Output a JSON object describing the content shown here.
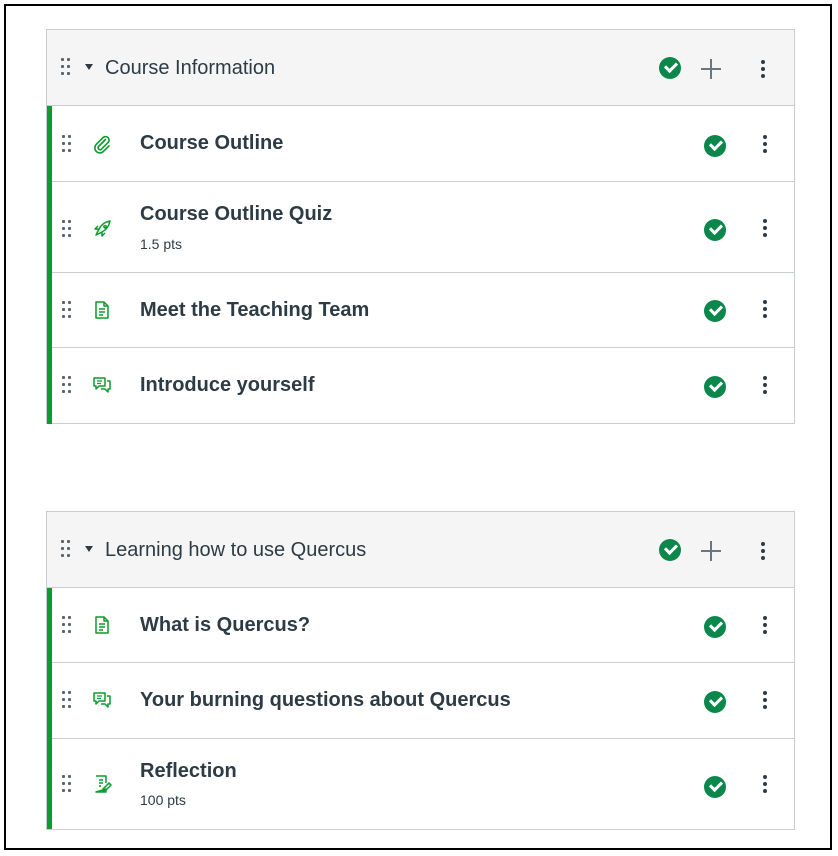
{
  "modules": [
    {
      "title": "Course Information",
      "items": [
        {
          "title": "Course Outline",
          "points": "",
          "icon": "attachment-icon"
        },
        {
          "title": "Course Outline Quiz",
          "points": "1.5 pts",
          "icon": "quiz-rocket-icon"
        },
        {
          "title": "Meet the Teaching Team",
          "points": "",
          "icon": "page-document-icon"
        },
        {
          "title": "Introduce yourself",
          "points": "",
          "icon": "discussion-icon"
        }
      ]
    },
    {
      "title": "Learning how to use Quercus",
      "items": [
        {
          "title": "What is Quercus?",
          "points": "",
          "icon": "page-document-icon"
        },
        {
          "title": "Your burning questions about Quercus",
          "points": "",
          "icon": "discussion-icon"
        },
        {
          "title": "Reflection",
          "points": "100 pts",
          "icon": "assignment-icon"
        }
      ]
    }
  ],
  "colors": {
    "published_green": "#0b874b",
    "module_border_green": "#0b9c2e",
    "icon_green": "#0b9c2e",
    "text_dark": "#2d3b45",
    "header_bg": "#f5f5f5"
  }
}
